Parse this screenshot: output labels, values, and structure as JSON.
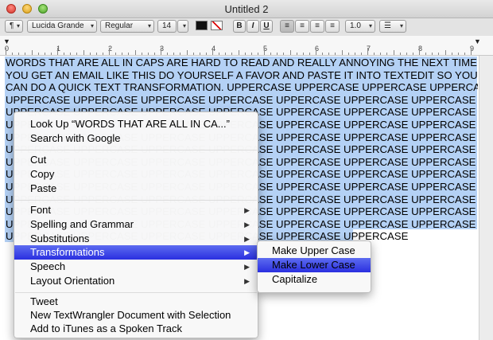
{
  "window": {
    "title": "Untitled 2"
  },
  "toolbar": {
    "paragraph_style": "¶",
    "font_family": "Lucida Grande",
    "font_style": "Regular",
    "font_size": "14",
    "bold": "B",
    "italic": "I",
    "underline": "U",
    "line_spacing": "1.0",
    "list_style": "☰"
  },
  "ruler": {
    "numbers": [
      "0",
      "1",
      "2",
      "3",
      "4",
      "5",
      "6",
      "7",
      "8",
      "9"
    ]
  },
  "document": {
    "lines": [
      "WORDS THAT ARE ALL IN CAPS ARE HARD TO READ AND REALLY ANNOYING THE NEXT TIME",
      "YOU GET AN EMAIL LIKE THIS DO YOURSELF A FAVOR AND PASTE IT INTO TEXTEDIT SO YOU",
      "CAN DO A QUICK TEXT TRANSFORMATION. UPPERCASE UPPERCASE UPPERCASE UPPERCASE",
      "UPPERCASE UPPERCASE UPPERCASE UPPERCASE UPPERCASE UPPERCASE UPPERCASE",
      "UPPERCASE UPPERCASE UPPERCASE UPPERCASE UPPERCASE UPPERCASE UPPERCASE",
      "UPPERCASE UPPERCASE UPPERCASE UPPERCASE UPPERCASE UPPERCASE UPPERCASE",
      "UPPERCASE UPPERCASE UPPERCASE UPPERCASE UPPERCASE UPPERCASE UPPERCASE",
      "UPPERCASE UPPERCASE UPPERCASE UPPERCASE UPPERCASE UPPERCASE UPPERCASE",
      "UPPERCASE UPPERCASE UPPERCASE UPPERCASE UPPERCASE UPPERCASE UPPERCASE",
      "UPPERCASE UPPERCASE UPPERCASE UPPERCASE UPPERCASE UPPERCASE UPPERCASE",
      "UPPERCASE UPPERCASE UPPERCASE UPPERCASE UPPERCASE UPPERCASE UPPERCASE",
      "UPPERCASE UPPERCASE UPPERCASE UPPERCASE UPPERCASE UPPERCASE UPPERCASE",
      "UPPERCASE UPPERCASE UPPERCASE UPPERCASE UPPERCASE UPPERCASE UPPERCASE",
      "UPPERCASE UPPERCASE UPPERCASE UPPERCASE UPPERCASE UPPERCASE UPPERCASE",
      "UPPERCASE UPPERCASE UPPERCASE UPPERCASE UPPERCASE UPPERCASE"
    ]
  },
  "context_menu": {
    "items": [
      {
        "label": "Look Up “WORDS THAT ARE ALL IN CA...”"
      },
      {
        "label": "Search with Google"
      },
      {
        "label": "Cut"
      },
      {
        "label": "Copy"
      },
      {
        "label": "Paste"
      },
      {
        "label": "Font"
      },
      {
        "label": "Spelling and Grammar"
      },
      {
        "label": "Substitutions"
      },
      {
        "label": "Transformations"
      },
      {
        "label": "Speech"
      },
      {
        "label": "Layout Orientation"
      },
      {
        "label": "Tweet"
      },
      {
        "label": "New TextWrangler Document with Selection"
      },
      {
        "label": "Add to iTunes as a Spoken Track"
      }
    ]
  },
  "transformations_submenu": {
    "items": [
      {
        "label": "Make Upper Case"
      },
      {
        "label": "Make Lower Case"
      },
      {
        "label": "Capitalize"
      }
    ]
  },
  "colors": {
    "selection": "#b4d1f5",
    "menu_highlight": "#2a2fe0"
  }
}
